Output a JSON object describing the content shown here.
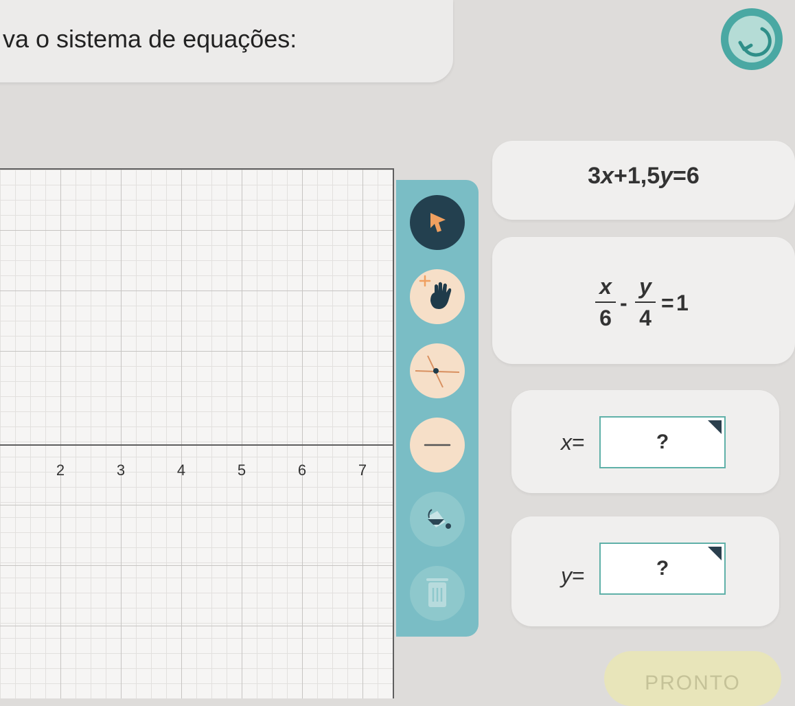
{
  "prompt": {
    "text": "va o sistema de equações:"
  },
  "icons": {
    "reset": "reset-arrow-icon",
    "tools": [
      "pointer-icon",
      "move-hand-icon",
      "point-tool-icon",
      "line-tool-icon",
      "paint-bucket-icon",
      "trash-icon"
    ]
  },
  "graph": {
    "x_tick_labels": [
      "2",
      "3",
      "4",
      "5",
      "6",
      "7"
    ]
  },
  "equations": {
    "eq1": {
      "coef_x": "3",
      "var_x": "x",
      "plus": "+",
      "coef_y": "1,5",
      "var_y": "y",
      "equals": "=",
      "rhs": "6"
    },
    "eq2": {
      "num1": "x",
      "den1": "6",
      "minus": "-",
      "num2": "y",
      "den2": "4",
      "equals": "=",
      "rhs": "1"
    }
  },
  "answers": {
    "x": {
      "var": "x",
      "equals": "=",
      "value": "?"
    },
    "y": {
      "var": "y",
      "equals": "=",
      "value": "?"
    }
  },
  "done_label": "PRONTO",
  "colors": {
    "toolbar": "#7abdc5",
    "tool_selected": "#23404f",
    "tool_idle": "#f6dfc8",
    "answer_border": "#5fb0a8",
    "reset_ring": "#4aa8a3",
    "done_button": "#e8e5ba"
  }
}
